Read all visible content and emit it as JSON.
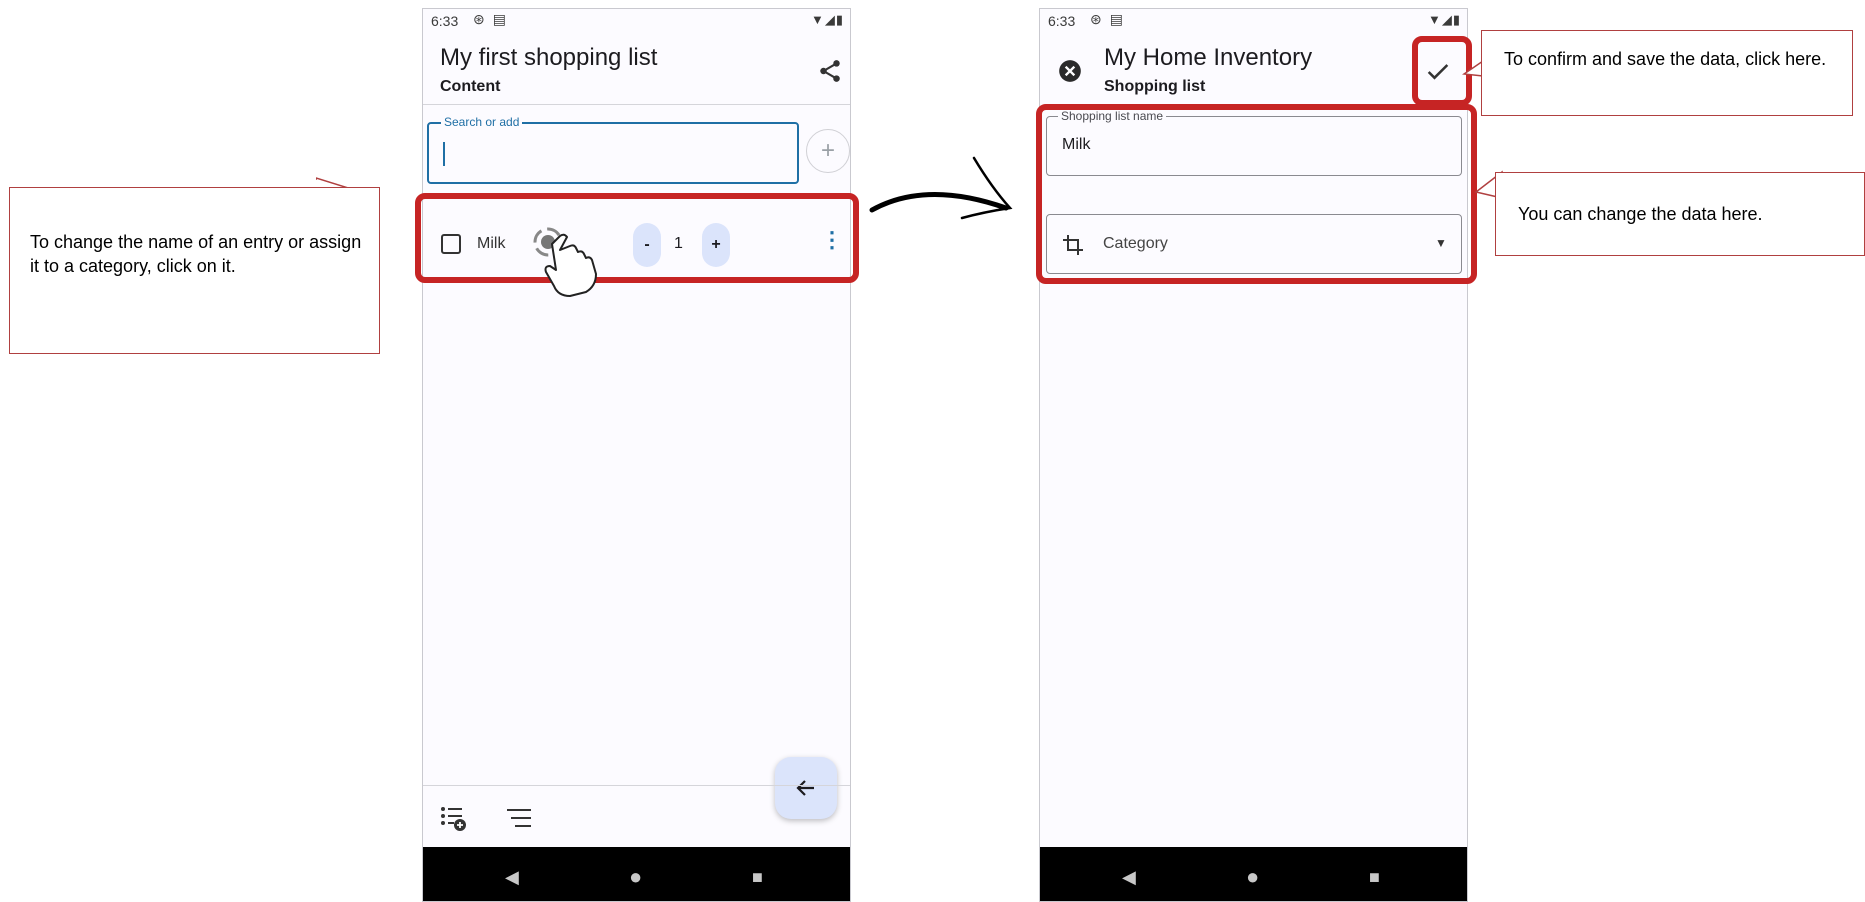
{
  "left_phone": {
    "status": {
      "time": "6:33"
    },
    "header": {
      "title": "My first shopping list",
      "subtitle": "Content"
    },
    "search": {
      "label": "Search or add"
    },
    "item": {
      "name": "Milk",
      "minus": "-",
      "quantity": "1",
      "plus": "+"
    },
    "icons": {
      "share": "share-icon",
      "add": "plus-icon",
      "checkbox": "checkbox-icon",
      "more": "more-vertical-icon",
      "fab": "arrow-left-icon",
      "bottom_left": "list-add-icon",
      "bottom_right": "sort-icon"
    }
  },
  "right_phone": {
    "status": {
      "time": "6:33"
    },
    "header": {
      "title": "My Home Inventory",
      "subtitle": "Shopping list"
    },
    "name_field": {
      "label": "Shopping list name",
      "value": "Milk"
    },
    "category": {
      "label": "Category"
    },
    "icons": {
      "close": "close-circle-icon",
      "confirm": "check-icon",
      "category": "crop-icon",
      "dropdown": "dropdown-arrow-icon"
    }
  },
  "callouts": {
    "left": "To change the name of an entry or assign it to a category, click on it.",
    "confirm": "To confirm and save the data, click here.",
    "change": "You can change the data here."
  },
  "colors": {
    "highlight": "#c62424",
    "accent": "#1f6fa5",
    "pill_bg": "#dbe4fb",
    "fab_bg": "#dbe4fb"
  }
}
